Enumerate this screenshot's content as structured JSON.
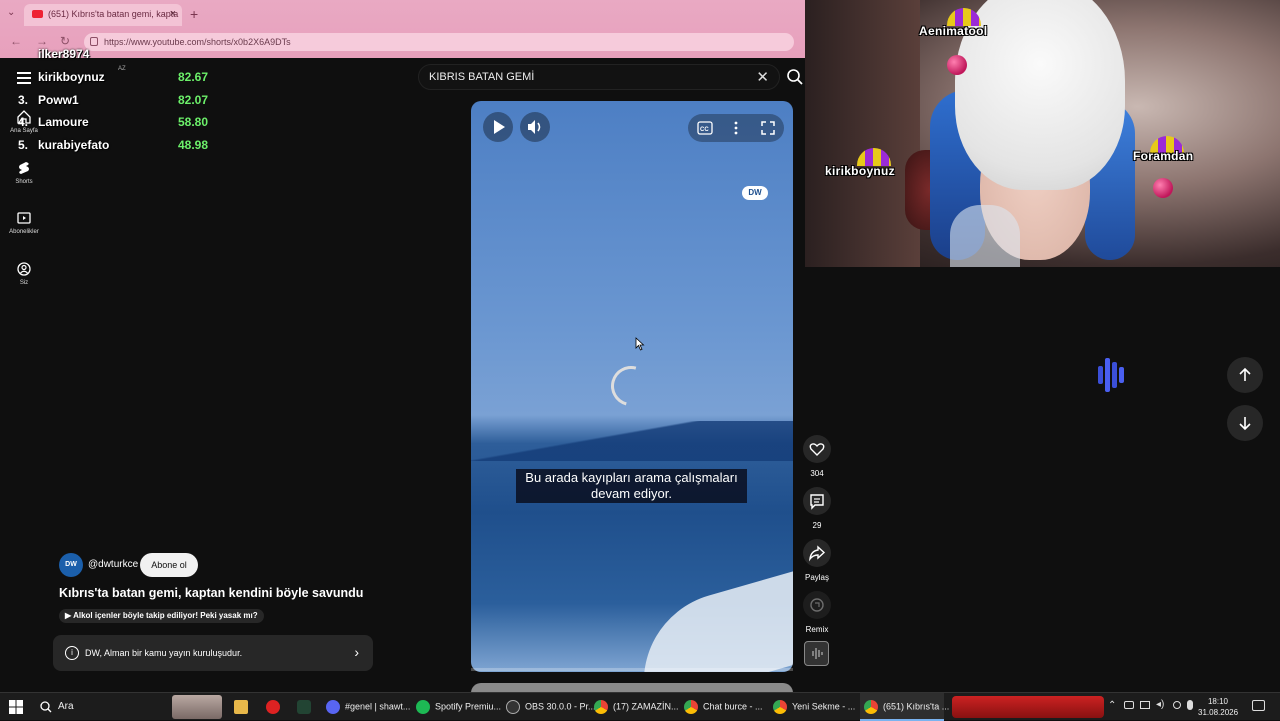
{
  "browser": {
    "tab_title": "(651) Kıbrıs'ta batan gemi, kapta",
    "url": "https://www.youtube.com/shorts/x0b2X6A9DTs"
  },
  "leaderboard": [
    {
      "rank": "",
      "name": "ilker8974",
      "value": ""
    },
    {
      "rank": "",
      "name": "kirikboynuz",
      "value": "82.67"
    },
    {
      "rank": "3.",
      "name": "Poww1",
      "value": "82.07"
    },
    {
      "rank": "4.",
      "name": "Lamoure",
      "value": "58.80"
    },
    {
      "rank": "5.",
      "name": "kurabiyefato",
      "value": "48.98"
    }
  ],
  "nav": {
    "home": "Ana Sayfa",
    "shorts": "Shorts",
    "subscriptions": "Abonelikler",
    "you": "Siz",
    "country": "AZ"
  },
  "search": {
    "query": "KIBRIS BATAN GEMİ"
  },
  "video": {
    "subtitle": "Bu arada kayıpları arama çalışmaları devam ediyor.",
    "watermark": "DW",
    "progress_percent": 0
  },
  "actions": {
    "likes": "304",
    "comments": "29",
    "share": "Paylaş",
    "remix": "Remix"
  },
  "channel": {
    "handle": "@dwturkce",
    "logo_text": "DW",
    "subscribe": "Abone ol",
    "title": "Kıbrıs'ta batan gemi, kaptan kendini böyle savundu",
    "suggestion": "Alkol içenler böyle takip ediliyor! Peki yasak mı?",
    "info": "DW, Alman bir kamu yayın kuruluşudur."
  },
  "webcam": {
    "chatters": [
      "Aenimatool",
      "kirikboynuz",
      "Foramdan"
    ]
  },
  "taskbar": {
    "search": "Ara",
    "items": [
      "#genel | shawt...",
      "Spotify Premiu...",
      "OBS 30.0.0 - Pr...",
      "(17) ZAMAZİN...",
      "Chat burce - ...",
      "Yeni Sekme - ...",
      "(651) Kıbrıs'ta ..."
    ],
    "time": "18:10",
    "date": "31.08.2026"
  },
  "colors": {
    "youtube_bg": "#0f0f0f",
    "leaderboard_value": "#6cf06a",
    "progress": "#ff0000",
    "chrome_tint": "#e9a9c3"
  }
}
